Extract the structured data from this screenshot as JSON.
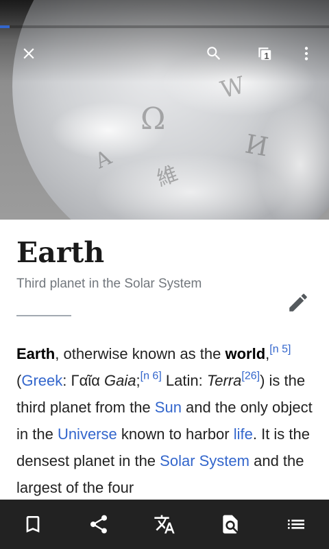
{
  "page_load": {
    "progress": 0.03
  },
  "toolbar": {
    "tab_count": "1",
    "icons": [
      "close-icon",
      "search-icon",
      "tabs-icon",
      "overflow-menu-icon"
    ]
  },
  "lead_image": {
    "glyphs": [
      "Ω",
      "W",
      "維",
      "И",
      "A"
    ]
  },
  "article": {
    "title": "Earth",
    "description": "Third planet in the Solar System",
    "paragraph": {
      "earth": "Earth",
      "t1": ", otherwise known as the ",
      "world": "world",
      "t2": ",",
      "note1": "[n 5]",
      "t3": " (",
      "greek_link": "Greek",
      "t4": ": Γαῖα ",
      "gaia": "Gaia",
      "t5": ";",
      "note2": "[n 6]",
      "t6": " Latin: ",
      "terra": "Terra",
      "ref": "[26]",
      "t7": ") is the third planet from the ",
      "sun_link": "Sun",
      "t8": " and the only object in the ",
      "universe_link": "Universe",
      "t9": " known to harbor ",
      "life_link": "life",
      "t10": ". It is the densest planet in the ",
      "solar_system_link": "Solar System",
      "t11": " and the largest of the four"
    }
  },
  "bottom_bar": {
    "icons": [
      "bookmark-icon",
      "share-icon",
      "translate-icon",
      "find-in-page-icon",
      "contents-icon"
    ]
  },
  "colors": {
    "link": "#3366cc",
    "bottom_bar_bg": "#222222",
    "title_text": "#1a1a1a",
    "description_text": "#72777d"
  }
}
